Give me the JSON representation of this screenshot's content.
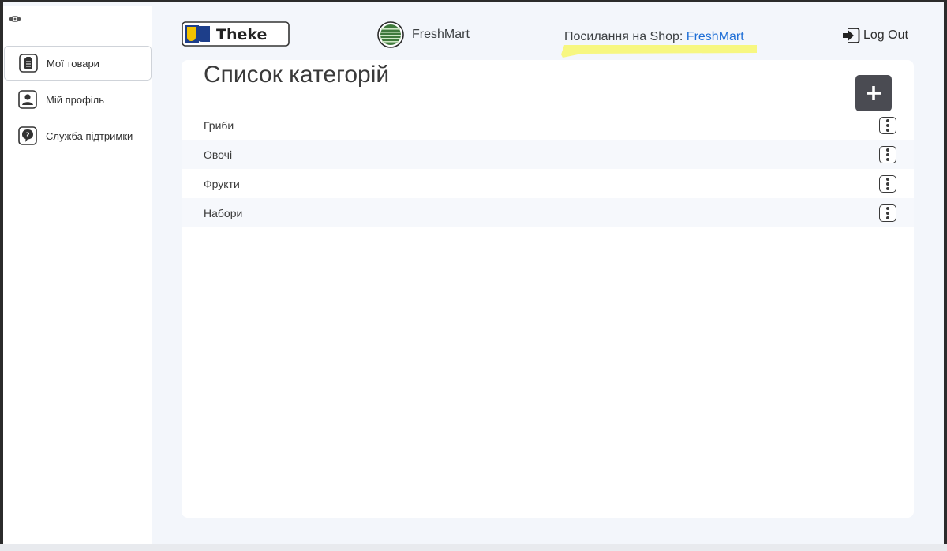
{
  "sidebar": {
    "items": [
      {
        "label": "Мої товари",
        "icon": "clipboard-icon",
        "active": true
      },
      {
        "label": "Мій профіль",
        "icon": "profile-icon",
        "active": false
      },
      {
        "label": "Служба підтримки",
        "icon": "support-icon",
        "active": false
      }
    ]
  },
  "header": {
    "logo_text": "Theke",
    "store_name": "FreshMart",
    "shop_link_prefix": "Посилання на Shop: ",
    "shop_link_text": "FreshMart",
    "logout_label": "Log Out"
  },
  "main": {
    "title": "Список категорій",
    "add_label": "+",
    "categories": [
      "Гриби",
      "Овочі",
      "Фрукти",
      "Набори"
    ]
  },
  "colors": {
    "accent_link": "#1f6fd6",
    "add_button": "#4a4b52",
    "highlight": "#f7f77a"
  }
}
